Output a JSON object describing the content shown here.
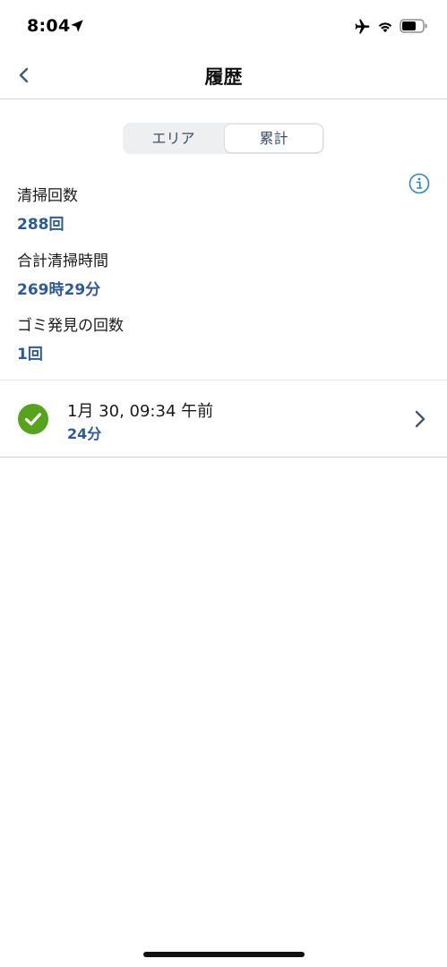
{
  "status_bar": {
    "time": "8:04",
    "icons": [
      "location-arrow-icon",
      "airplane-icon",
      "wifi-icon",
      "battery-icon"
    ]
  },
  "nav": {
    "title": "履歴",
    "back_icon": "chevron-left-icon"
  },
  "segmented_control": {
    "segments": [
      {
        "label": "エリア",
        "selected": false
      },
      {
        "label": "累計",
        "selected": true
      }
    ]
  },
  "stats": [
    {
      "label": "清掃回数",
      "value": "288回"
    },
    {
      "label": "合計清掃時間",
      "value": "269時29分"
    },
    {
      "label": "ゴミ発見の回数",
      "value": "1回"
    }
  ],
  "history": [
    {
      "date": "1月 30, 09:34 午前",
      "duration": "24分",
      "status_icon": "check-circle-icon"
    }
  ],
  "colors": {
    "accent": "#2f5a92",
    "success": "#58a31d",
    "info": "#2e86c1"
  }
}
